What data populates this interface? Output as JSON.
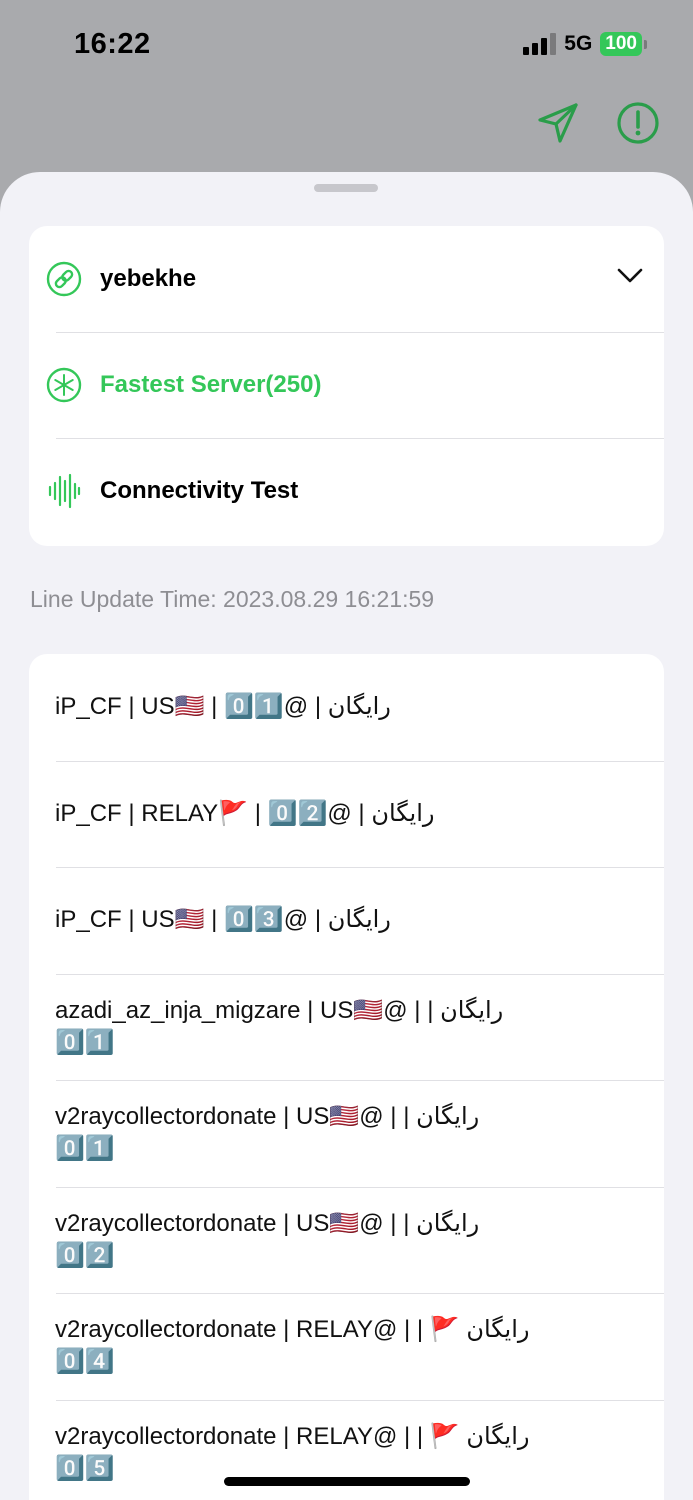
{
  "status_bar": {
    "time": "16:22",
    "network": "5G",
    "battery": "100"
  },
  "top_actions": {
    "send_icon": "paper-plane-icon",
    "info_icon": "exclamation-circle-icon"
  },
  "menu": {
    "subscription_name": "yebekhe",
    "fastest_server": "Fastest Server(250)",
    "connectivity_test": "Connectivity Test"
  },
  "line_update_time": "Line Update Time: 2023.08.29 16:21:59",
  "servers": [
    {
      "label": "iP_CF | US🇺🇸 | 0️⃣1️⃣@ | رایگان"
    },
    {
      "label": "iP_CF | RELAY🚩 | 0️⃣2️⃣@ | رایگان"
    },
    {
      "label": "iP_CF | US🇺🇸 | 0️⃣3️⃣@ | رایگان"
    },
    {
      "label": "azadi_az_inja_migzare | US🇺🇸@ | رایگان | 0️⃣1️⃣"
    },
    {
      "label": "v2raycollectordonate | US🇺🇸@ | رایگان | 0️⃣1️⃣"
    },
    {
      "label": "v2raycollectordonate | US🇺🇸@ | رایگان | 0️⃣2️⃣"
    },
    {
      "label": "v2raycollectordonate | RELAY@ | رایگان 🚩 | 0️⃣4️⃣"
    },
    {
      "label": "v2raycollectordonate | RELAY@ | رایگان 🚩 | 0️⃣5️⃣"
    }
  ],
  "colors": {
    "accent": "#34c759",
    "sheet_background": "#f2f2f7",
    "dimmed_background": "#a9aaad"
  }
}
